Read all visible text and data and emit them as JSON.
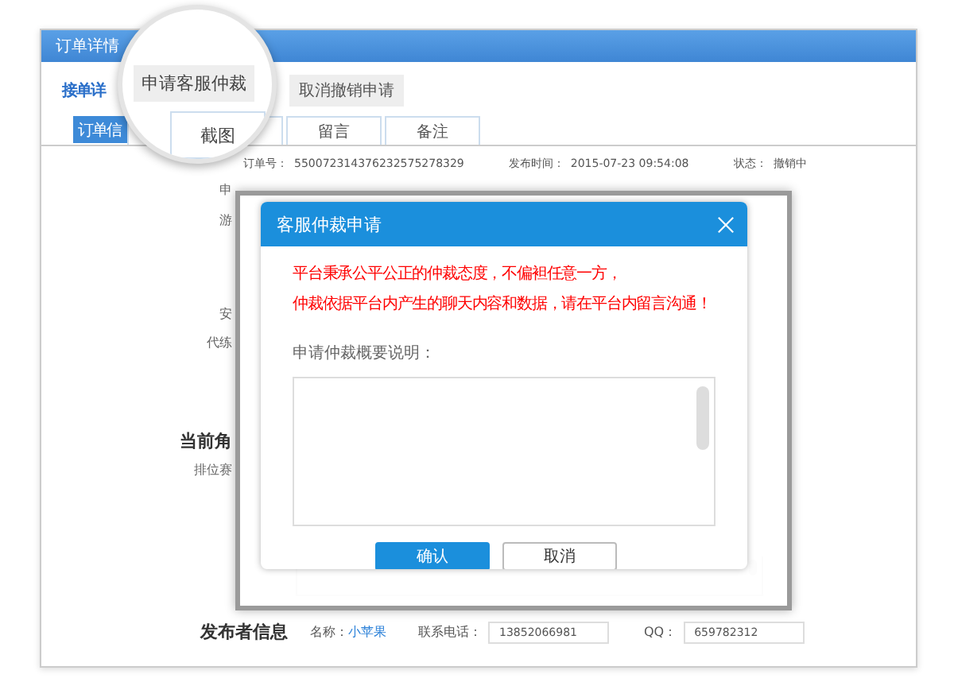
{
  "window": {
    "title": "订单详情"
  },
  "subtabs": [
    {
      "label": "接单详",
      "selected": true
    },
    {
      "label": "取消撤销申请",
      "selected": false
    }
  ],
  "tabs": [
    {
      "label": "订单信",
      "selected": true
    },
    {
      "label": "留言",
      "selected": false
    },
    {
      "label": "备注",
      "selected": false
    }
  ],
  "magnifier": {
    "button": "申请客服仲裁",
    "tab": "截图"
  },
  "info": [
    {
      "label": "订单号：",
      "value": "550072314376232575278329"
    },
    {
      "label": "发布时间：",
      "value": "2015-07-23 09:54:08"
    },
    {
      "label": "状态：",
      "value": "撤销中"
    }
  ],
  "side_labels": [
    {
      "text": "申",
      "kind": "field"
    },
    {
      "text": "游",
      "kind": "field"
    },
    {
      "text": "安",
      "kind": "field"
    },
    {
      "text": "代练",
      "kind": "field"
    },
    {
      "text": "当前角",
      "kind": "heading"
    },
    {
      "text": "排位赛",
      "kind": "field"
    }
  ],
  "publisher": {
    "heading": "发布者信息",
    "name_label": "名称：",
    "name": "小苹果",
    "phone_label": "联系电话：",
    "phone": "13852066981",
    "qq_label": "QQ：",
    "qq": "659782312"
  },
  "dialog": {
    "title": "客服仲裁申请",
    "notice": [
      "平台秉承公平公正的仲裁态度，不偏袒任意一方，",
      "仲裁依据平台内产生的聊天内容和数据，请在平台内留言沟通！"
    ],
    "field_label": "申请仲裁概要说明：",
    "buttons": [
      {
        "label": "确认",
        "kind": "primary"
      },
      {
        "label": "取消",
        "kind": "secondary"
      }
    ]
  }
}
